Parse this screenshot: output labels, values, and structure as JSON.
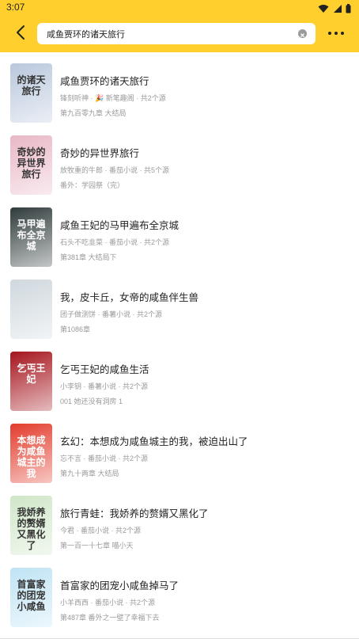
{
  "status_bar": {
    "time": "3:07"
  },
  "search": {
    "query": "咸鱼贾环的诸天旅行"
  },
  "books": [
    {
      "title": "咸鱼贾环的诸天旅行",
      "meta": "锋刻听神 · 🎉 新笔趣阁 · 共2个源",
      "latest": "第九百零九章 大结局",
      "cover_text": "的诸天旅行",
      "cover_color": "#b9c7dd"
    },
    {
      "title": "奇妙的异世界旅行",
      "meta": "放牧重的牛郎 · 番茄小说 · 共5个源",
      "latest": "番外：学园祭（完）",
      "cover_text": "奇妙的异世界旅行",
      "cover_color": "#e9b7c6"
    },
    {
      "title": "咸鱼王妃的马甲遍布全京城",
      "meta": "石头不吃韭菜 · 番茄小说 · 共2个源",
      "latest": "第381章 大结局下",
      "cover_text": "马甲遍布全京城",
      "cover_color": "#2f3a3a"
    },
    {
      "title": "我，皮卡丘，女帝的咸鱼伴生兽",
      "meta": "团子做测饼 · 番薯小说 · 共2个源",
      "latest": "第1086章",
      "cover_text": "",
      "cover_color": "#cfd8de"
    },
    {
      "title": "乞丐王妃的咸鱼生活",
      "meta": "小李钥 · 番薯小说 · 共2个源",
      "latest": "001 她还没有洞房 1",
      "cover_text": "乞丐王妃",
      "cover_color": "#a5141c"
    },
    {
      "title": "玄幻：本想成为咸鱼城主的我，被迫出山了",
      "meta": "忘不言 · 番茄小说 · 共2个源",
      "latest": "第九十两章 大结局",
      "cover_text": "本想成为咸鱼城主的我",
      "cover_color": "#e23b2b"
    },
    {
      "title": "旅行青蛙：我娇养的赘婿又黑化了",
      "meta": "今君 · 番茄小说 · 共2个源",
      "latest": "第一百一十七章 喵小天",
      "cover_text": "我娇养的赘婿又黑化了",
      "cover_color": "#cfe6c8"
    },
    {
      "title": "首富家的团宠小咸鱼掉马了",
      "meta": "小羊西西 · 番茄小说 · 共2个源",
      "latest": "第487章 番外之一壁了幸福下去",
      "cover_text": "首富家的团宠小咸鱼",
      "cover_color": "#bfe3f4"
    }
  ]
}
